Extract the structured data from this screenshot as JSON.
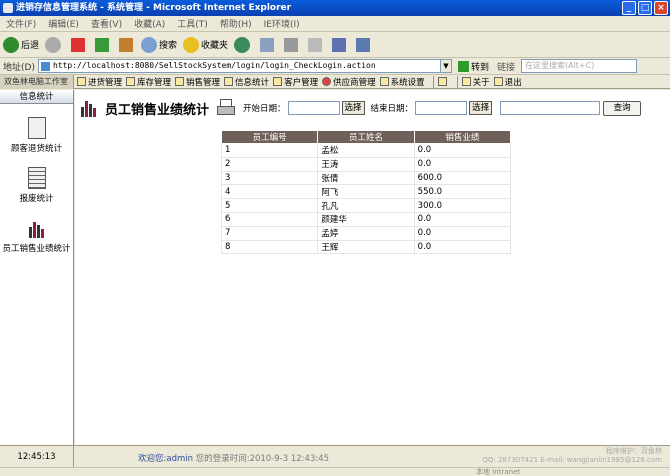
{
  "window": {
    "title": "进销存信息管理系统 - 系统管理 - Microsoft Internet Explorer",
    "min": "_",
    "max": "□",
    "close": "×"
  },
  "menu": [
    "文件(F)",
    "编辑(E)",
    "查看(V)",
    "收藏(A)",
    "工具(T)",
    "帮助(H)",
    "IE环境(I)"
  ],
  "toolbar": {
    "back": "后退",
    "search": "搜索",
    "favorites": "收藏夹"
  },
  "address": {
    "label": "地址(D)",
    "url": "http://localhost:8080/SellStockSystem/login/login_CheckLogin.action",
    "go": "转到",
    "links": "链接",
    "search_placeholder": "在这里搜索(Alt+C)"
  },
  "app": {
    "brand": "双鱼林电脑工作室",
    "nav": [
      "进货管理",
      "库存管理",
      "销售管理",
      "信息统计",
      "客户管理",
      "供应商管理",
      "系统设置"
    ],
    "about": "关于",
    "exit": "退出"
  },
  "sidebar": {
    "header": "信息统计",
    "items": [
      {
        "label": "顾客退货统计"
      },
      {
        "label": "报废统计"
      },
      {
        "label": "员工销售业绩统计"
      }
    ]
  },
  "main": {
    "title": "员工销售业绩统计",
    "start_label": "开始日期：",
    "end_label": "结束日期：",
    "select_label": "选择",
    "query_label": "查询",
    "table": {
      "headers": [
        "员工编号",
        "员工姓名",
        "销售业绩"
      ],
      "rows": [
        [
          "1",
          "孟松",
          "0.0"
        ],
        [
          "2",
          "王涛",
          "0.0"
        ],
        [
          "3",
          "张倩",
          "600.0"
        ],
        [
          "4",
          "阿飞",
          "550.0"
        ],
        [
          "5",
          "孔凡",
          "300.0"
        ],
        [
          "6",
          "颜建华",
          "0.0"
        ],
        [
          "7",
          "孟婷",
          "0.0"
        ],
        [
          "8",
          "王辉",
          "0.0"
        ]
      ]
    }
  },
  "status": {
    "time": "12:45:13",
    "welcome": "欢迎您:admin",
    "login_prefix": "您的登录时间:",
    "login_time": "2010-9-3 12:43:45",
    "copyright1": "程序维护：双鱼林",
    "copyright2": "QQ: 287307421  E-mail: wangjianlin1985@126.com"
  },
  "ie": {
    "zone": "本地 Intranet"
  }
}
